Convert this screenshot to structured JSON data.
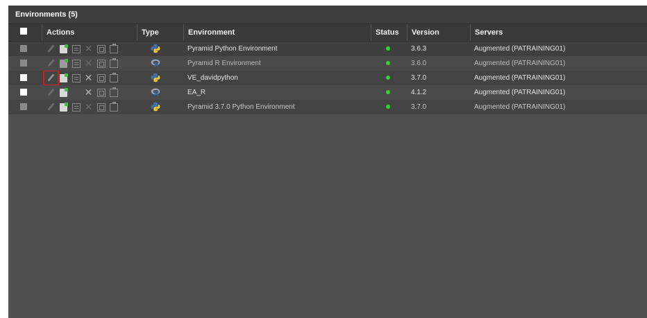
{
  "panel": {
    "title": "Environments (5)"
  },
  "columns": {
    "actions": "Actions",
    "type": "Type",
    "environment": "Environment",
    "status": "Status",
    "version": "Version",
    "servers": "Servers"
  },
  "colors": {
    "status_ok": "#35d035",
    "highlight": "#e01818"
  },
  "rows": [
    {
      "type": "python-icon",
      "environment": "Pyramid Python Environment",
      "status": "running",
      "version": "3.6.3",
      "servers": "Augmented (PATRAINING01)"
    },
    {
      "type": "r-icon",
      "environment": "Pyramid R Environment",
      "status": "running",
      "version": "3.6.0",
      "servers": "Augmented (PATRAINING01)"
    },
    {
      "type": "python-icon",
      "environment": "VE_davidpython",
      "status": "running",
      "version": "3.7.0",
      "servers": "Augmented (PATRAINING01)"
    },
    {
      "type": "r-icon",
      "environment": "EA_R",
      "status": "running",
      "version": "4.1.2",
      "servers": "Augmented (PATRAINING01)"
    },
    {
      "type": "python-icon",
      "environment": "Pyramid 3.7.0 Python Environment",
      "status": "running",
      "version": "3.7.0",
      "servers": "Augmented (PATRAINING01)"
    }
  ]
}
